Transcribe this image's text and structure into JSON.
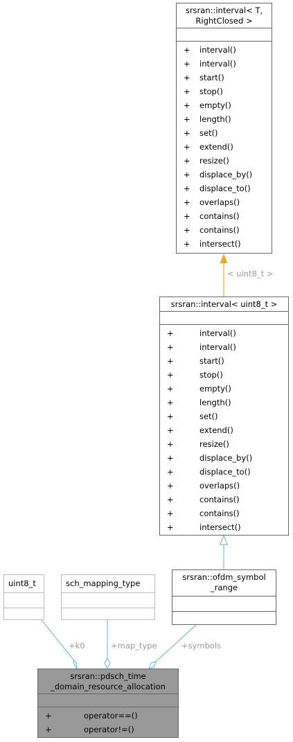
{
  "nodes": {
    "template_interval": {
      "title": "srsran::interval< T,\nRightClosed >",
      "members": [
        "interval()",
        "interval()",
        "start()",
        "stop()",
        "empty()",
        "length()",
        "set()",
        "extend()",
        "resize()",
        "displace_by()",
        "displace_to()",
        "overlaps()",
        "contains()",
        "contains()",
        "intersect()"
      ]
    },
    "interval_uint8": {
      "title": "srsran::interval< uint8_t >",
      "members": [
        "interval()",
        "interval()",
        "start()",
        "stop()",
        "empty()",
        "length()",
        "set()",
        "extend()",
        "resize()",
        "displace_by()",
        "displace_to()",
        "overlaps()",
        "contains()",
        "contains()",
        "intersect()"
      ]
    },
    "uint8_t": {
      "title": "uint8_t"
    },
    "sch_mapping_type": {
      "title": "sch_mapping_type"
    },
    "ofdm_symbol_range": {
      "title": "srsran::ofdm_symbol\n_range"
    },
    "pdsch_alloc": {
      "title": "srsran::pdsch_time\n_domain_resource_allocation",
      "members": [
        "operator==()",
        "operator!=()"
      ]
    }
  },
  "visibility": "+",
  "edge_labels": {
    "template_arg": "< uint8_t >",
    "k0": "+k0",
    "map_type": "+map_type",
    "symbols": "+symbols"
  },
  "colors": {
    "inherit": "#9ac8e8",
    "template": "#f5a623",
    "composition": "#6bb5e0"
  }
}
